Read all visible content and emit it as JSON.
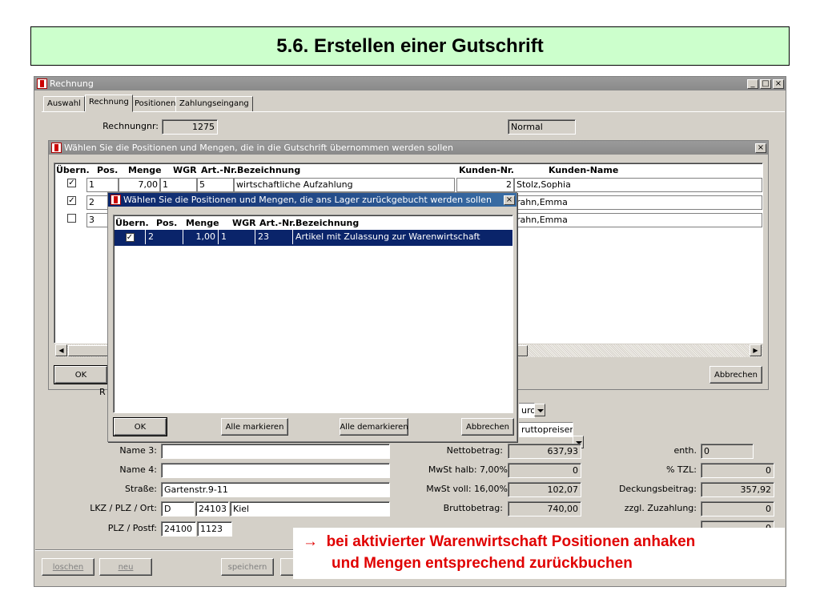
{
  "slide": {
    "title": "5.6. Erstellen einer Gutschrift",
    "callout_arrow": "→",
    "callout_line1": "bei aktivierter Warenwirtschaft Positionen anhaken",
    "callout_line2": "und Mengen entsprechend zurückbuchen"
  },
  "main_window": {
    "title": "Rechnung",
    "min_glyph": "_",
    "max_glyph": "□",
    "close_glyph": "×",
    "tabs": [
      "Auswahl",
      "Rechnung",
      "Positionen",
      "Zahlungseingang"
    ],
    "rechnungnr_label": "Rechnungnr:",
    "rechnungnr_value": "1275",
    "type_value": "Normal"
  },
  "dialog1": {
    "title": "Wählen Sie die Positionen und Mengen, die in die Gutschrift übernommen werden sollen",
    "close_glyph": "×",
    "headers": {
      "uebern": "Übern.",
      "pos": "Pos.",
      "menge": "Menge",
      "wgr": "WGR",
      "artnr": "Art.-Nr.",
      "bezeichnung": "Bezeichnung",
      "kundennr": "Kunden-Nr.",
      "kundenname": "Kunden-Name"
    },
    "rows": [
      {
        "checked": true,
        "check": "✓",
        "pos": "1",
        "menge": "7,00",
        "wgr": "1",
        "artnr": "5",
        "bezeichnung": "wirtschaftliche Aufzahlung",
        "kundennr": "2",
        "kundenname": "Stolz,Sophia"
      },
      {
        "checked": true,
        "check": "✓",
        "pos": "2",
        "kundenname": "rahn,Emma"
      },
      {
        "checked": false,
        "check": "",
        "pos": "3",
        "kundenname": "rahn,Emma"
      }
    ],
    "ok_label": "OK",
    "abbrechen_label": "Abbrechen",
    "scroll_left": "◀",
    "scroll_right": "▶"
  },
  "dialog2": {
    "title": "Wählen Sie die Positionen und Mengen, die ans Lager zurückgebucht werden sollen",
    "close_glyph": "×",
    "headers": {
      "uebern": "Übern.",
      "pos": "Pos.",
      "menge": "Menge",
      "wgr": "WGR",
      "artnr": "Art.-Nr.",
      "bezeichnung": "Bezeichnung"
    },
    "row": {
      "check": "✓",
      "pos": "2",
      "menge": "1,00",
      "wgr": "1",
      "artnr": "23",
      "bezeichnung": "Artikel mit Zulassung zur Warenwirtschaft"
    },
    "ok_label": "OK",
    "alle_markieren_label": "Alle markieren",
    "alle_demarkieren_label": "Alle demarkieren",
    "abbrechen_label": "Abbrechen"
  },
  "form": {
    "hidden_label_fragment": "R",
    "currency_value": "uro",
    "price_mode_value": "ruttopreisen",
    "name3_label": "Name 3:",
    "name3_value": "",
    "name4_label": "Name 4:",
    "name4_value": "",
    "strasse_label": "Straße:",
    "strasse_value": "Gartenstr.9-11",
    "ort_label": "LKZ / PLZ / Ort:",
    "lkz_value": "D",
    "plz_value": "24103",
    "ort_value": "Kiel",
    "postf_label": "PLZ / Postf:",
    "postf_plz_value": "24100",
    "postf_value": "1123",
    "netto_label": "Nettobetrag:",
    "netto_value": "637,93",
    "mwst_halb_label": "MwSt halb:  7,00%",
    "mwst_halb_value": "0",
    "mwst_voll_label": "MwSt voll:  16,00%",
    "mwst_voll_value": "102,07",
    "brutto_label": "Bruttobetrag:",
    "brutto_value": "740,00",
    "enth_label": "enth.",
    "enth_value": "0",
    "tzl_label": "% TZL:",
    "tzl_value": "0",
    "deckung_label": "Deckungsbeitrag:",
    "deckung_value": "357,92",
    "zuzahlung_label": "zzgl. Zuzahlung:",
    "zuzahlung_value": "0",
    "eigenanteil_value": "0"
  },
  "bottom_buttons": {
    "loeschen": "loschen",
    "neu": "neu",
    "speichern": "speichern"
  }
}
